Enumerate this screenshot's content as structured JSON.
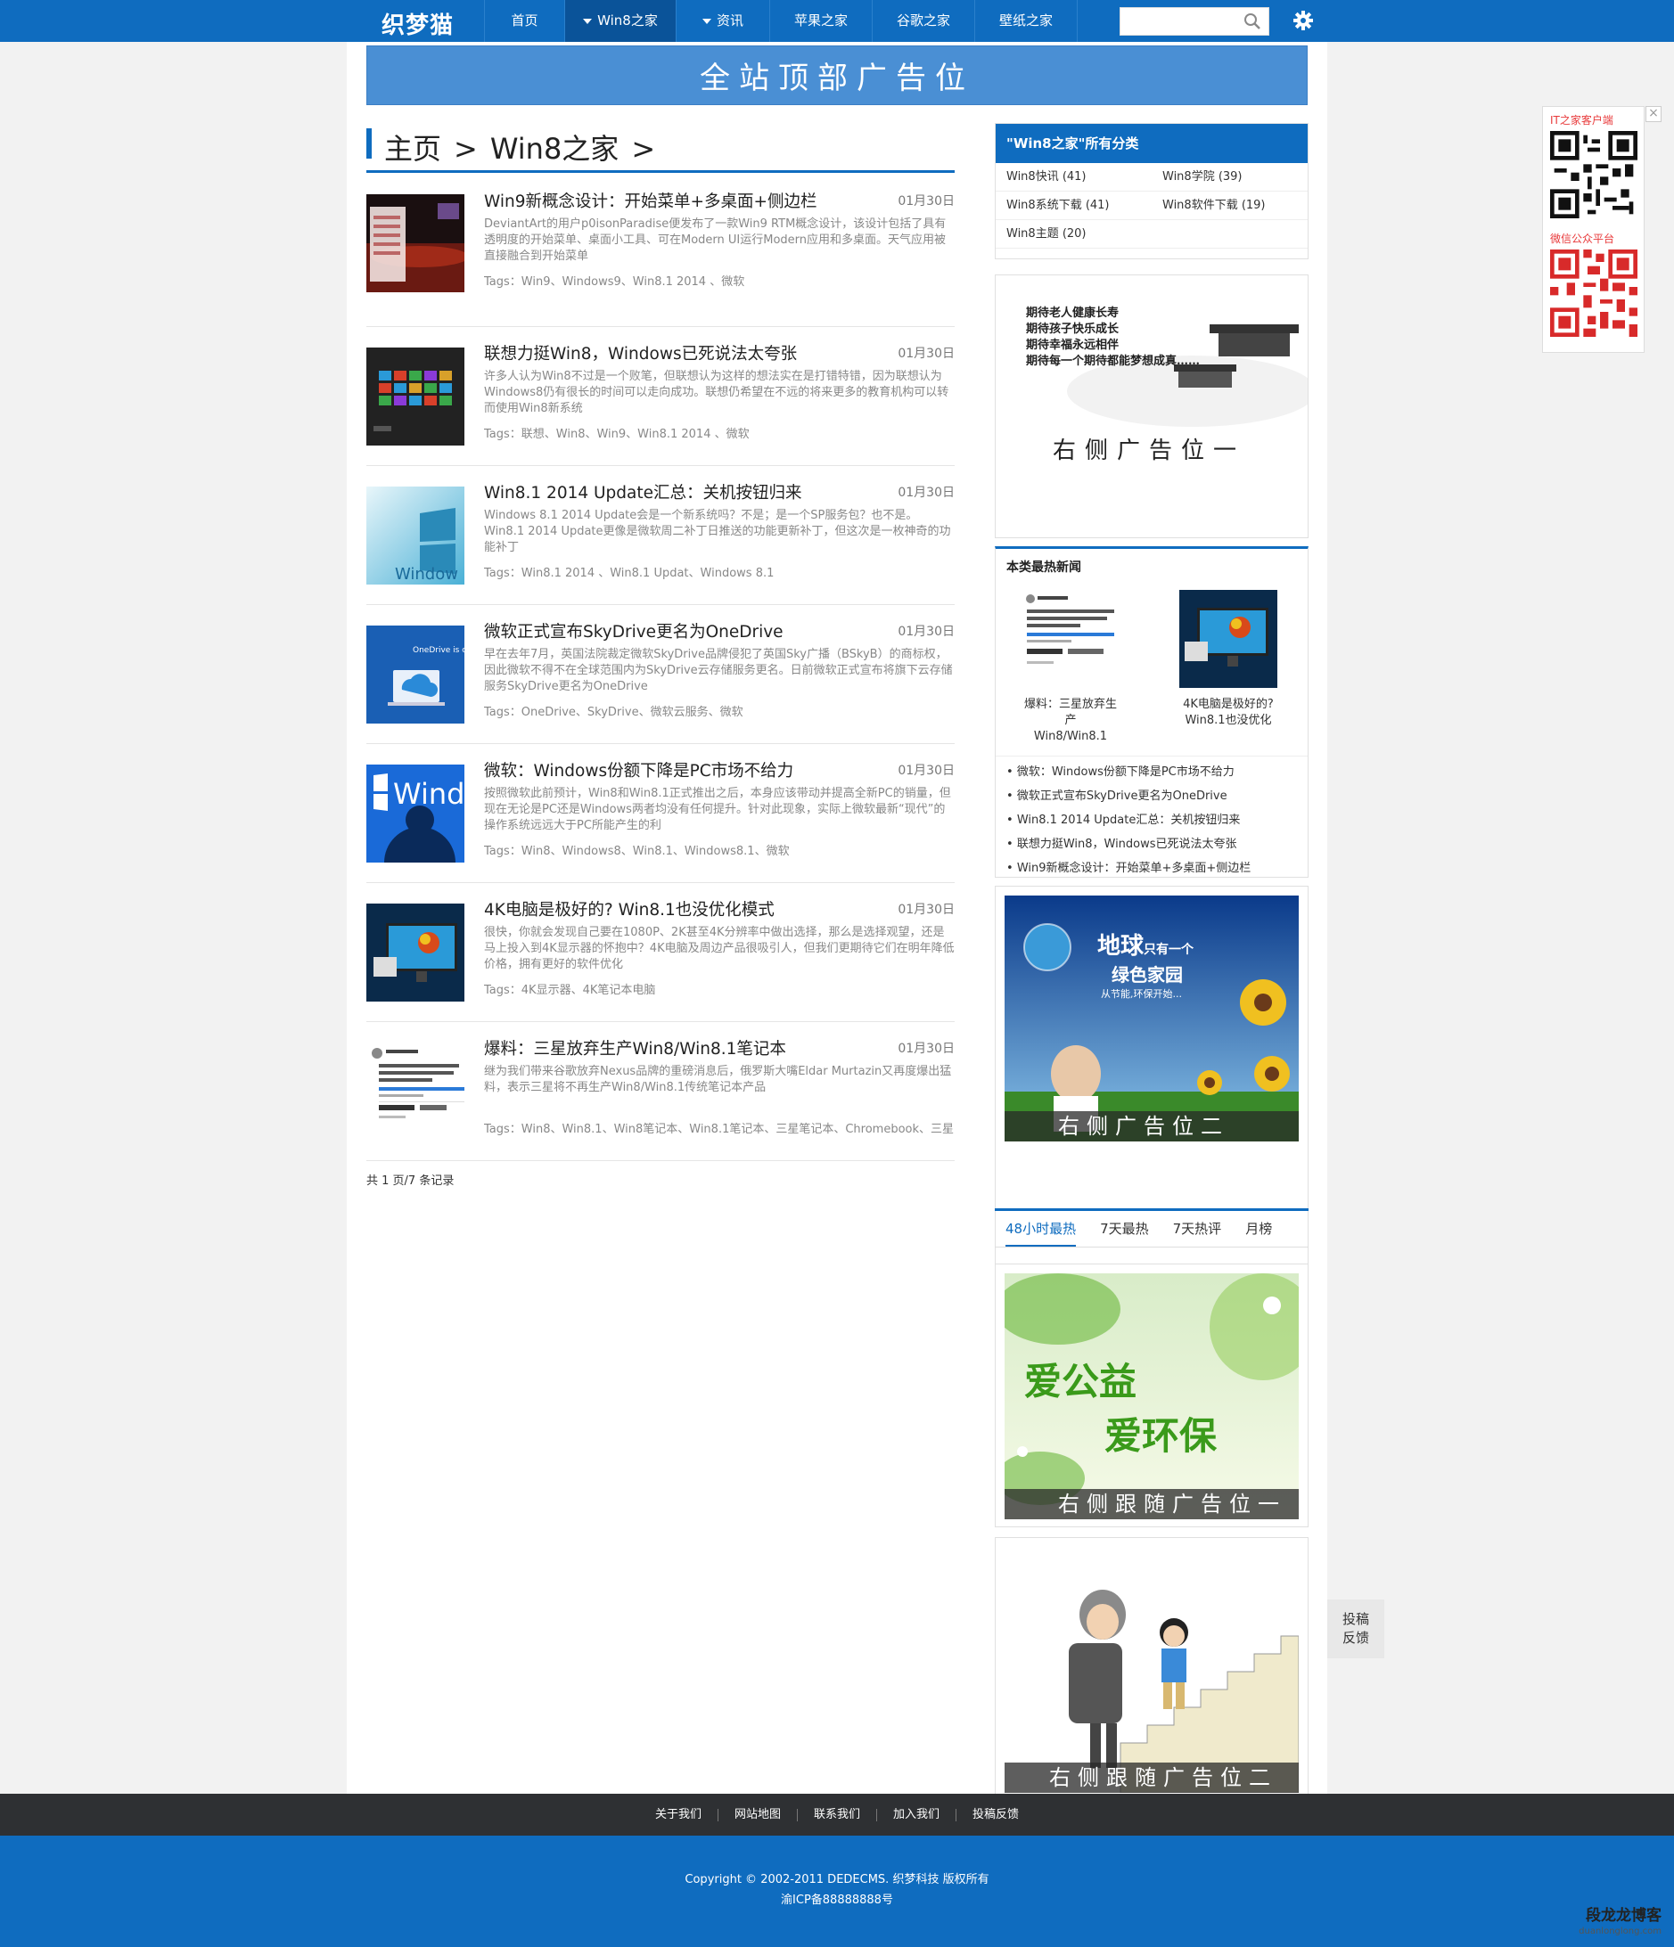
{
  "nav": {
    "logo": "织梦猫",
    "items": [
      {
        "label": "首页",
        "caret": false,
        "active": false
      },
      {
        "label": "Win8之家",
        "caret": true,
        "active": true
      },
      {
        "label": "资讯",
        "caret": true,
        "active": false
      },
      {
        "label": "苹果之家",
        "caret": false,
        "active": false
      },
      {
        "label": "谷歌之家",
        "caret": false,
        "active": false
      },
      {
        "label": "壁纸之家",
        "caret": false,
        "active": false
      }
    ],
    "search_value": ""
  },
  "top_ad": "全站顶部广告位",
  "breadcrumb": [
    "主页",
    ">",
    "Win8之家",
    ">"
  ],
  "articles": [
    {
      "title": "Win9新概念设计：开始菜单+多桌面+侧边栏",
      "date": "01月30日",
      "desc": "DeviantArt的用户p0isonParadise便发布了一款Win9 RTM概念设计，该设计包括了具有透明度的开始菜单、桌面小工具、可在Modern UI运行Modern应用和多桌面。天气应用被直接融合到开始菜单",
      "tags": "Tags：Win9、Windows9、Win8.1 2014 、微软"
    },
    {
      "title": "联想力挺Win8，Windows已死说法太夸张",
      "date": "01月30日",
      "desc": "许多人认为Win8不过是一个败笔，但联想认为这样的想法实在是打错特错，因为联想认为Windows8仍有很长的时间可以走向成功。联想仍希望在不远的将来更多的教育机构可以转而使用Win8新系统",
      "tags": "Tags：联想、Win8、Win9、Win8.1 2014 、微软"
    },
    {
      "title": "Win8.1 2014 Update汇总：关机按钮归来",
      "date": "01月30日",
      "desc": "Windows 8.1 2014 Update会是一个新系统吗？不是；是一个SP服务包？也不是。Win8.1 2014 Update更像是微软周二补丁日推送的功能更新补丁，但这次是一枚神奇的功能补丁",
      "tags": "Tags：Win8.1 2014 、Win8.1 Updat、Windows 8.1"
    },
    {
      "title": "微软正式宣布SkyDrive更名为OneDrive",
      "date": "01月30日",
      "desc": "早在去年7月，英国法院裁定微软SkyDrive品牌侵犯了英国Sky广播（BSkyB）的商标权，因此微软不得不在全球范围内为SkyDrive云存储服务更名。日前微软正式宣布将旗下云存储服务SkyDrive更名为OneDrive",
      "tags": "Tags：OneDrive、SkyDrive、微软云服务、微软"
    },
    {
      "title": "微软：Windows份额下降是PC市场不给力",
      "date": "01月30日",
      "desc": "按照微软此前预计，Win8和Win8.1正式推出之后，本身应该带动并提高全新PC的销量，但现在无论是PC还是Windows两者均没有任何提升。针对此现象，实际上微软最新“现代”的操作系统远远大于PC所能产生的利",
      "tags": "Tags：Win8、Windows8、Win8.1、Windows8.1、微软"
    },
    {
      "title": "4K电脑是极好的? Win8.1也没优化模式",
      "date": "01月30日",
      "desc": "很快，你就会发现自己要在1080P、2K甚至4K分辨率中做出选择，那么是选择观望，还是马上投入到4K显示器的怀抱中？4K电脑及周边产品很吸引人，但我们更期待它们在明年降低价格，拥有更好的软件优化",
      "tags": "Tags：4K显示器、4K笔记本电脑"
    },
    {
      "title": "爆料：三星放弃生产Win8/Win8.1笔记本",
      "date": "01月30日",
      "desc": "继为我们带来谷歌放弃Nexus品牌的重磅消息后，俄罗斯大嘴Eldar Murtazin又再度爆出猛料，表示三星将不再生产Win8/Win8.1传统笔记本产品",
      "tags": "Tags：Win8、Win8.1、Win8笔记本、Win8.1笔记本、三星笔记本、Chromebook、三星"
    }
  ],
  "page_info": "共 1 页/7 条记录",
  "sidebar": {
    "cat_title": "\"Win8之家\"所有分类",
    "categories": [
      "Win8快讯 (41)",
      "Win8学院 (39)",
      "Win8系统下载 (41)",
      "Win8软件下载 (19)",
      "Win8主题 (20)"
    ],
    "ad1_lines": [
      "期待老人健康长寿",
      "期待孩子快乐成长",
      "期待幸福永远相伴",
      "期待每一个期待都能梦想成真……"
    ],
    "ad1_label": "右侧广告位一",
    "hot_title": "本类最热新闻",
    "hot_pics": [
      {
        "cap1": "爆料：三星放弃生产",
        "cap2": "Win8/Win8.1"
      },
      {
        "cap1": "4K电脑是极好的?",
        "cap2": "Win8.1也没优化"
      }
    ],
    "hot_list": [
      "微软：Windows份额下降是PC市场不给力",
      "微软正式宣布SkyDrive更名为OneDrive",
      "Win8.1 2014 Update汇总：关机按钮归来",
      "联想力挺Win8，Windows已死说法太夸张",
      "Win9新概念设计：开始菜单+多桌面+侧边栏"
    ],
    "ad2_title1": "地球",
    "ad2_title1b": "只有一个",
    "ad2_title2": "绿色家园",
    "ad2_sub": "从节能,环保开始...",
    "ad2_label": "右侧广告位二",
    "tabs": [
      "48小时最热",
      "7天最热",
      "7天热评",
      "月榜"
    ],
    "ad3_t1": "爱公益",
    "ad3_t2": "爱环保",
    "ad3_label": "右侧跟随广告位一",
    "ad4_label": "右侧跟随广告位二"
  },
  "qr": {
    "label1": "IT之家客户端",
    "label2": "微信公众平台",
    "close": "×"
  },
  "feedback": [
    "投稿",
    "反馈"
  ],
  "footer": {
    "links": [
      "关于我们",
      "网站地图",
      "联系我们",
      "加入我们",
      "投稿反馈"
    ],
    "copyright": "Copyright © 2002-2011 DEDECMS. 织梦科技 版权所有",
    "icp": "渝ICP备88888888号",
    "watermark": "段龙龙博客",
    "watermark_url": "duanlonglong.com"
  },
  "colors": {
    "brand": "#0f6cbf",
    "footer_dark": "#2e3033"
  }
}
